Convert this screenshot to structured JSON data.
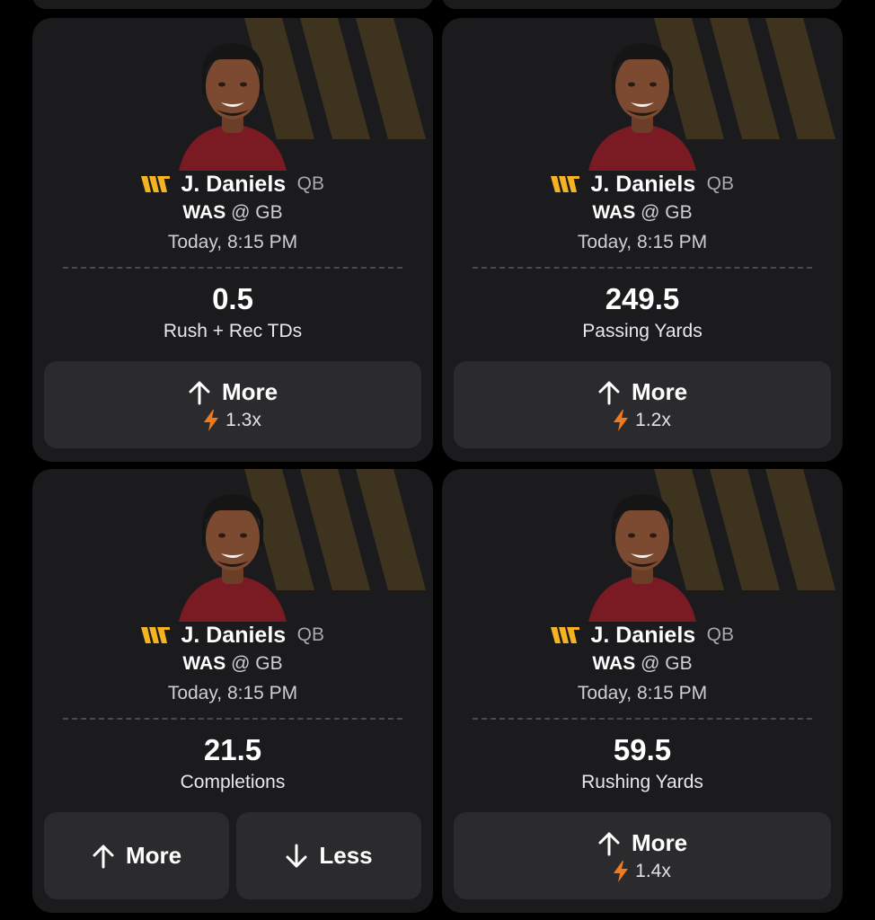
{
  "colors": {
    "background": "#000000",
    "card": "#1b1b1d",
    "button": "#2b2b2e",
    "team_gold": "#f5b324",
    "boost_orange": "#f07a1c",
    "jersey": "#7a1a22"
  },
  "cards": [
    {
      "player": {
        "name": "J. Daniels",
        "position": "QB"
      },
      "matchup": {
        "team": "WAS",
        "separator": "@",
        "opponent": "GB"
      },
      "game_time": "Today, 8:15 PM",
      "line": "0.5",
      "stat": "Rush + Rec TDs",
      "more": {
        "label": "More",
        "icon": "arrow-up-icon",
        "multiplier": "1.3x",
        "multiplier_icon": "lightning-icon"
      }
    },
    {
      "player": {
        "name": "J. Daniels",
        "position": "QB"
      },
      "matchup": {
        "team": "WAS",
        "separator": "@",
        "opponent": "GB"
      },
      "game_time": "Today, 8:15 PM",
      "line": "249.5",
      "stat": "Passing Yards",
      "more": {
        "label": "More",
        "icon": "arrow-up-icon",
        "multiplier": "1.2x",
        "multiplier_icon": "lightning-icon"
      }
    },
    {
      "player": {
        "name": "J. Daniels",
        "position": "QB"
      },
      "matchup": {
        "team": "WAS",
        "separator": "@",
        "opponent": "GB"
      },
      "game_time": "Today, 8:15 PM",
      "line": "21.5",
      "stat": "Completions",
      "more": {
        "label": "More",
        "icon": "arrow-up-icon"
      },
      "less": {
        "label": "Less",
        "icon": "arrow-down-icon"
      }
    },
    {
      "player": {
        "name": "J. Daniels",
        "position": "QB"
      },
      "matchup": {
        "team": "WAS",
        "separator": "@",
        "opponent": "GB"
      },
      "game_time": "Today, 8:15 PM",
      "line": "59.5",
      "stat": "Rushing Yards",
      "more": {
        "label": "More",
        "icon": "arrow-up-icon",
        "multiplier": "1.4x",
        "multiplier_icon": "lightning-icon"
      }
    }
  ]
}
